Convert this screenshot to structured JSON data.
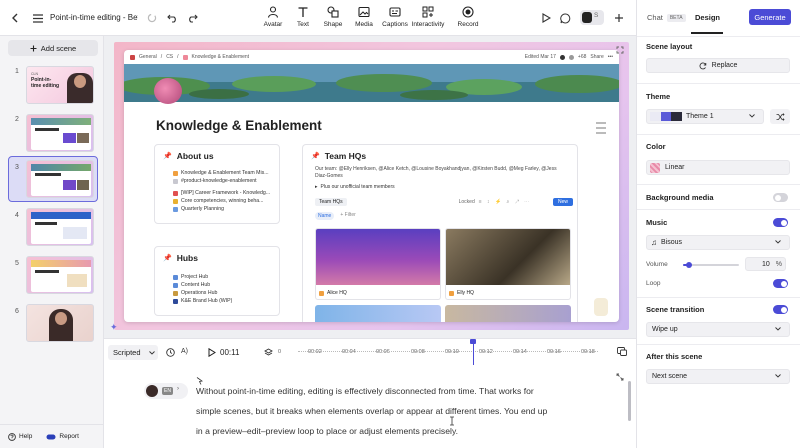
{
  "header": {
    "doc_title": "Point-in-time editing - Beta",
    "tools": [
      {
        "label": "Avatar",
        "icon": "avatar-icon"
      },
      {
        "label": "Text",
        "icon": "text-icon"
      },
      {
        "label": "Shape",
        "icon": "shape-icon"
      },
      {
        "label": "Media",
        "icon": "media-icon"
      },
      {
        "label": "Captions",
        "icon": "captions-icon"
      },
      {
        "label": "Interactivity",
        "icon": "interactivity-icon"
      },
      {
        "label": "Record",
        "icon": "record-icon"
      }
    ],
    "share_badge": "S"
  },
  "left": {
    "add_scene": "Add scene",
    "scenes": [
      {
        "num": "1",
        "thumb_title": "Point-in-time editing",
        "thumb_brand": "CLN"
      },
      {
        "num": "2"
      },
      {
        "num": "3"
      },
      {
        "num": "4"
      },
      {
        "num": "5"
      },
      {
        "num": "6"
      }
    ],
    "help": "Help",
    "report": "Report"
  },
  "canvas": {
    "breadcrumb_1": "General",
    "breadcrumb_2": "CS",
    "breadcrumb_3": "Knowledge & Enablement",
    "edited": "Edited Mar 17",
    "share": "Share",
    "count": "+68",
    "page_title": "Knowledge & Enablement",
    "about_title": "About us",
    "about_items": [
      "Knowledge & Enablement Team Mis...",
      "#product-knowledge-enablement",
      "[WIP] Career Framework - Knowledg...",
      "Core competencies, winning beha...",
      "Quarterly Planning"
    ],
    "hubs_title": "Hubs",
    "hubs_items": [
      "Project Hub",
      "Content Hub",
      "Operations Hub",
      "K&E Brand Hub (WIP)"
    ],
    "team_title": "Team HQs",
    "team_line1": "Our team: @Elly Henriksen, @Alice Ketch, @Lousine Boyakhandjyan, @Kirsten Budd, @Meg Farley, @Jess",
    "team_line2": "Diaz-Gomes",
    "team_toggle": "Plus our unofficial team members",
    "team_view": "Team HQs",
    "locked": "Locked",
    "new_btn": "New",
    "filter_name": "Name",
    "filter_add": "+ Filter",
    "gallery": [
      "Alice HQ",
      "Elly HQ"
    ],
    "colors": {
      "accent": "#4b4bd6",
      "purple1": "#6a3fb8",
      "pink": "#d06aa8"
    }
  },
  "timeline": {
    "mode": "Scripted",
    "time": "00:11",
    "ticks": [
      "0",
      "00:02",
      "00:04",
      "00:06",
      "00:08",
      "00:10",
      "00:12",
      "00:14",
      "00:16",
      "00:18"
    ],
    "avatar_lang": "EN",
    "script_lines": [
      "Without point-in-time editing, editing is effectively disconnected from time. That works for",
      "simple scenes, but it breaks when elements overlap or appear at different times. You end up",
      "in a preview–edit–preview loop to place or adjust elements precisely."
    ]
  },
  "right": {
    "tabs": [
      "Chat",
      "Design"
    ],
    "chat_badge": "BETA",
    "generate": "Generate",
    "scene_layout": "Scene layout",
    "replace": "Replace",
    "theme_label": "Theme",
    "theme_value": "Theme 1",
    "color_label": "Color",
    "color_value": "Linear",
    "bg_media": "Background media",
    "music_label": "Music",
    "music_value": "Bisous",
    "volume_label": "Volume",
    "volume_value": "10",
    "volume_unit": "%",
    "volume_fraction": 0.1,
    "loop_label": "Loop",
    "transition_label": "Scene transition",
    "transition_value": "Wipe up",
    "after_label": "After this scene",
    "after_value": "Next scene"
  }
}
